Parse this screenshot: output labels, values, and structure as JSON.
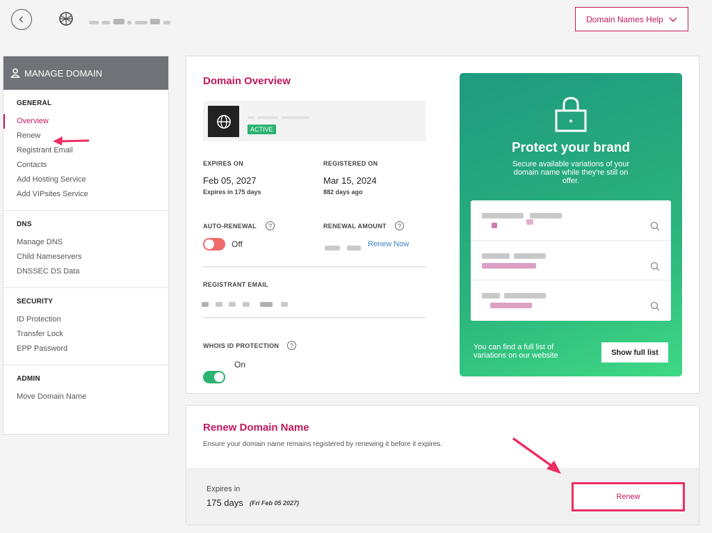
{
  "topbar": {
    "help_label": "Domain Names Help"
  },
  "sidebar": {
    "header": "MANAGE DOMAIN",
    "sections": [
      {
        "heading": "GENERAL",
        "items": [
          "Overview",
          "Renew",
          "Registrant Email",
          "Contacts",
          "Add Hosting Service",
          "Add VIPsites Service"
        ]
      },
      {
        "heading": "DNS",
        "items": [
          "Manage DNS",
          "Child Nameservers",
          "DNSSEC DS Data"
        ]
      },
      {
        "heading": "SECURITY",
        "items": [
          "ID Protection",
          "Transfer Lock",
          "EPP Password"
        ]
      },
      {
        "heading": "ADMIN",
        "items": [
          "Move Domain Name"
        ]
      }
    ]
  },
  "overview": {
    "title": "Domain Overview",
    "status_badge": "ACTIVE",
    "expires_label": "EXPIRES ON",
    "expires_value": "Feb 05, 2027",
    "expires_sub": "Expires in 175 days",
    "registered_label": "REGISTERED ON",
    "registered_value": "Mar 15, 2024",
    "registered_sub": "882 days ago",
    "autorenew_label": "AUTO-RENEWAL",
    "autorenew_state": "Off",
    "renewal_amount_label": "RENEWAL AMOUNT",
    "renew_now_link": "Renew Now",
    "registrant_email_label": "REGISTRANT EMAIL",
    "whois_label": "WHOIS ID PROTECTION",
    "whois_state": "On",
    "colors": {
      "accent": "#c2185b",
      "toggle_off": "#f06a6a",
      "toggle_on": "#2bb370",
      "link": "#3b82c4"
    }
  },
  "promo": {
    "title": "Protect your brand",
    "description": "Secure available variations of your domain name while they're still on offer.",
    "footer_text": "You can find a full list of variations on our website",
    "show_full_label": "Show full list"
  },
  "renew": {
    "title": "Renew Domain Name",
    "description": "Ensure your domain name remains registered by renewing it before it expires.",
    "expires_in_label": "Expires in",
    "days_value": "175 days",
    "date_value": "(Fri Feb 05 2027)",
    "button_label": "Renew"
  }
}
